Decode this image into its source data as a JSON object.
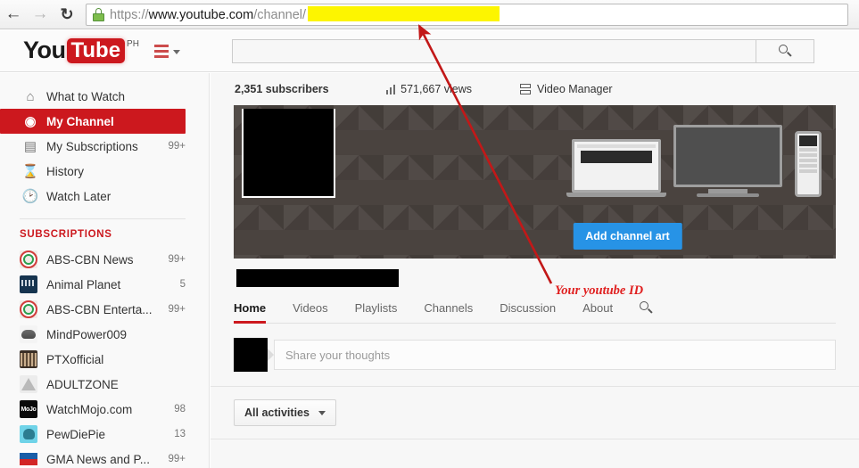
{
  "browser": {
    "back_icon": "back-arrow-icon",
    "forward_icon": "forward-arrow-icon",
    "reload_icon": "reload-icon",
    "lock_icon": "ssl-lock-icon",
    "url_scheme": "https://",
    "url_host": "www.youtube.com",
    "url_path": "/channel/",
    "url_redacted": true
  },
  "masthead": {
    "logo_you": "You",
    "logo_tube": "Tube",
    "country_code": "PH",
    "menu_icon": "hamburger-menu-icon",
    "search_value": "",
    "search_placeholder": "",
    "search_icon": "search-icon"
  },
  "sidebar": {
    "nav": [
      {
        "label": "What to Watch",
        "icon": "home-icon",
        "count": "",
        "active": false
      },
      {
        "label": "My Channel",
        "icon": "person-icon",
        "count": "",
        "active": true
      },
      {
        "label": "My Subscriptions",
        "icon": "subscriptions-icon",
        "count": "99+",
        "active": false
      },
      {
        "label": "History",
        "icon": "hourglass-icon",
        "count": "",
        "active": false
      },
      {
        "label": "Watch Later",
        "icon": "clock-icon",
        "count": "",
        "active": false
      }
    ],
    "section_title": "SUBSCRIPTIONS",
    "subscriptions": [
      {
        "label": "ABS-CBN News",
        "count": "99+",
        "avatar": "abscbn-news-avatar"
      },
      {
        "label": "Animal Planet",
        "count": "5",
        "avatar": "animal-planet-avatar"
      },
      {
        "label": "ABS-CBN Enterta...",
        "count": "99+",
        "avatar": "abscbn-entertainment-avatar"
      },
      {
        "label": "MindPower009",
        "count": "",
        "avatar": "mindpower009-avatar"
      },
      {
        "label": "PTXofficial",
        "count": "",
        "avatar": "ptxofficial-avatar"
      },
      {
        "label": "ADULTZONE",
        "count": "",
        "avatar": "adultzone-avatar"
      },
      {
        "label": "WatchMojo.com",
        "count": "98",
        "avatar": "watchmojo-avatar"
      },
      {
        "label": "PewDiePie",
        "count": "13",
        "avatar": "pewdiepie-avatar"
      },
      {
        "label": "GMA News and P...",
        "count": "99+",
        "avatar": "gma-news-avatar"
      }
    ]
  },
  "channel": {
    "subscribers": "2,351 subscribers",
    "views": "571,667 views",
    "views_icon": "bar-chart-icon",
    "video_manager": "Video Manager",
    "video_manager_icon": "video-manager-icon",
    "add_channel_art": "Add channel art",
    "name_redacted": true,
    "avatar_redacted": true,
    "tabs": [
      {
        "label": "Home",
        "active": true
      },
      {
        "label": "Videos",
        "active": false
      },
      {
        "label": "Playlists",
        "active": false
      },
      {
        "label": "Channels",
        "active": false
      },
      {
        "label": "Discussion",
        "active": false
      },
      {
        "label": "About",
        "active": false
      }
    ],
    "tab_search_icon": "search-icon"
  },
  "feed": {
    "share_placeholder": "Share your thoughts",
    "share_value": "",
    "activities_label": "All activities",
    "activities_caret": "chevron-down-icon"
  },
  "annotation": {
    "text": "Your youtube ID",
    "color": "#e02020",
    "arrow_icon": "red-arrow-icon",
    "highlight_color": "#fdf500"
  }
}
